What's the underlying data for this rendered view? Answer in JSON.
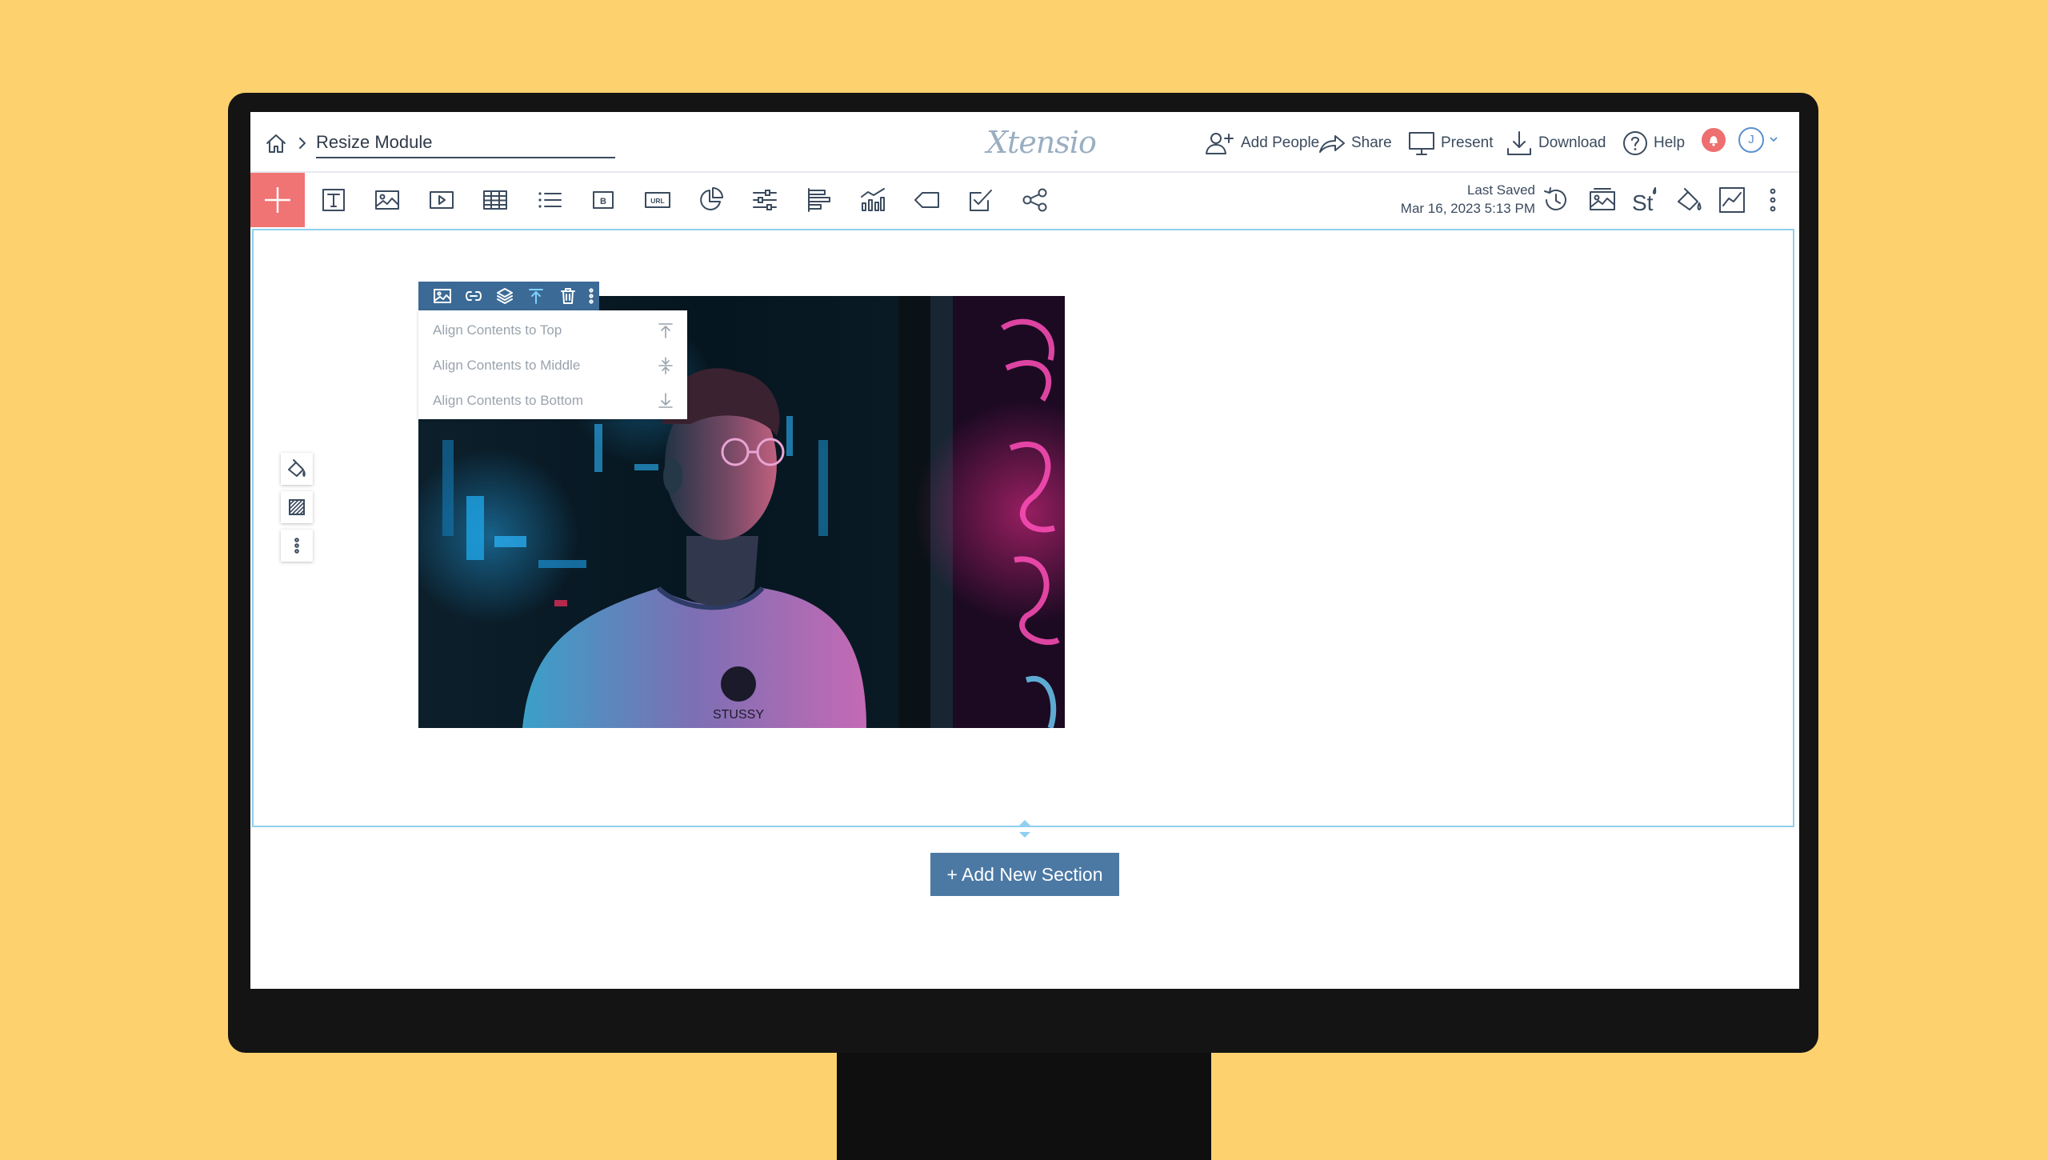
{
  "colors": {
    "background": "#fed16f",
    "accent_add": "#f07474",
    "toolbar_blue": "#3c6a96",
    "section_border": "#8fd0ef",
    "add_section_button": "#4b79a4",
    "notification": "#ee6f6f"
  },
  "header": {
    "breadcrumb_title": "Resize Module",
    "brand": "Xtensio",
    "actions": [
      {
        "label": "Add People",
        "icon": "add-person-icon"
      },
      {
        "label": "Share",
        "icon": "share-arrow-icon"
      },
      {
        "label": "Present",
        "icon": "monitor-icon"
      },
      {
        "label": "Download",
        "icon": "download-icon"
      },
      {
        "label": "Help",
        "icon": "help-circle-icon"
      }
    ],
    "avatar_initial": "J"
  },
  "toolbar": {
    "add_icon": "plus-icon",
    "tools": [
      "text-box-icon",
      "image-icon",
      "video-icon",
      "table-icon",
      "list-icon",
      "button-icon",
      "url-icon",
      "pie-chart-icon",
      "sliders-icon",
      "bar-align-icon",
      "chart-icon",
      "tag-icon",
      "checkbox-edit-icon",
      "share-network-icon"
    ],
    "last_saved_label": "Last Saved",
    "last_saved_date": "Mar 16, 2023 5:13 PM",
    "right_tools": [
      "history-icon",
      "background-image-icon",
      "style-icon",
      "paint-bucket-icon",
      "analytics-icon",
      "more-vertical-icon"
    ]
  },
  "image_toolbar": {
    "tools": [
      "image-icon",
      "link-icon",
      "layers-icon",
      "align-top-icon",
      "trash-icon",
      "more-vertical-icon"
    ],
    "active_tool": "align-top-icon"
  },
  "align_menu": {
    "items": [
      {
        "label": "Align Contents to Top",
        "icon": "align-top-icon"
      },
      {
        "label": "Align Contents to Middle",
        "icon": "align-middle-icon"
      },
      {
        "label": "Align Contents to Bottom",
        "icon": "align-bottom-icon"
      }
    ]
  },
  "section_tools": [
    "paint-bucket-icon",
    "pattern-icon",
    "more-vertical-icon"
  ],
  "image": {
    "shirt_text": "STUSSY"
  },
  "add_section_label": "+ Add New Section"
}
